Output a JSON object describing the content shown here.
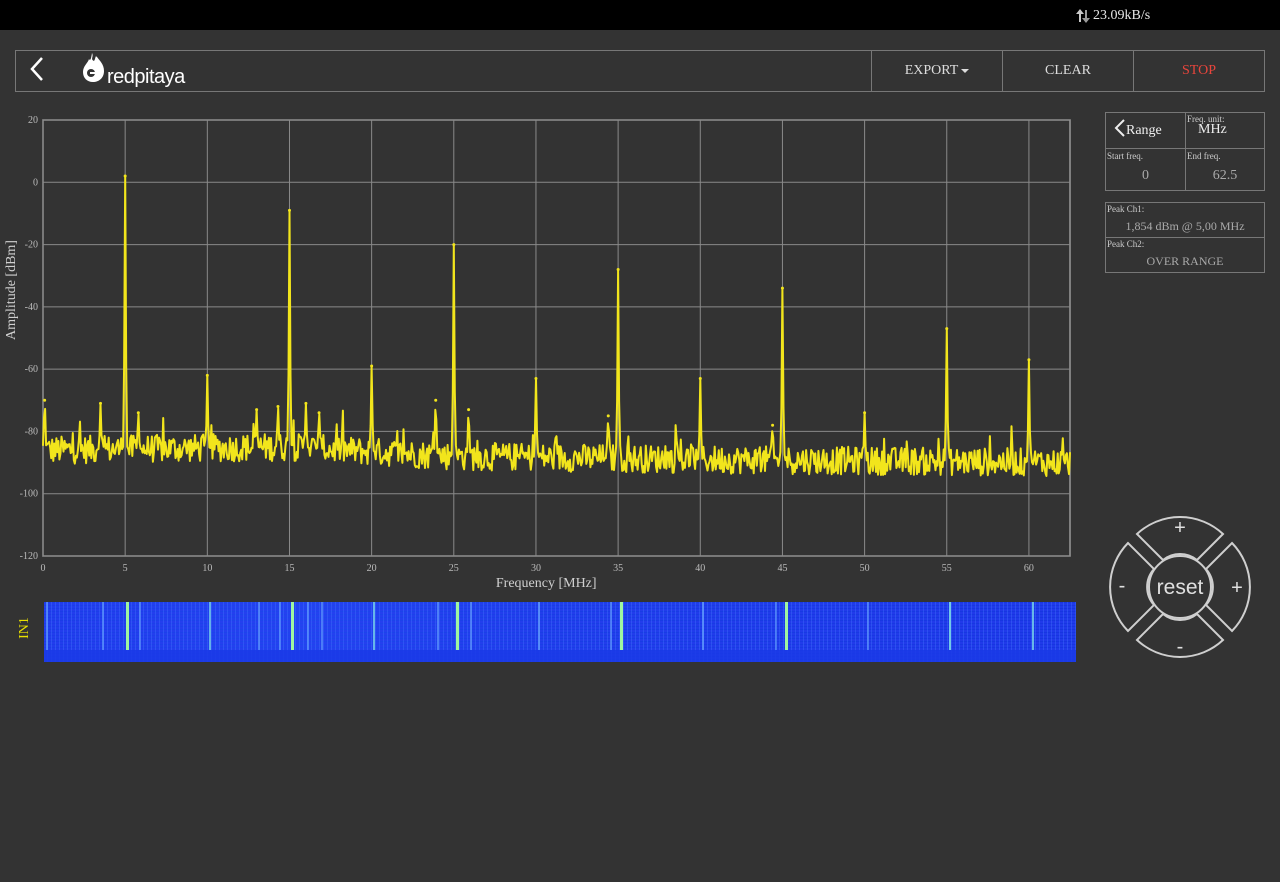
{
  "status_bar": {
    "transfer_rate": "23.09kB/s",
    "transfer_icon": "up-down-arrows-icon"
  },
  "header": {
    "back_icon": "chevron-left-icon",
    "logo_text": "redpitaya",
    "export_label": "EXPORT",
    "clear_label": "CLEAR",
    "stop_label": "STOP",
    "stop_color": "#e8453c"
  },
  "settings": {
    "range_label": "Range",
    "freq_unit_label": "Freq.  unit:",
    "freq_unit_value": "MHz",
    "start_freq_label": "Start  freq.",
    "start_freq_value": "0",
    "end_freq_label": "End  freq.",
    "end_freq_value": "62.5"
  },
  "peaks": {
    "ch1_label": "Peak  Ch1:",
    "ch1_value": "1,854  dBm  @  5,00  MHz",
    "ch2_label": "Peak  Ch2:",
    "ch2_value": "OVER RANGE"
  },
  "waterfall": {
    "channel_label": "IN1"
  },
  "dpad": {
    "center_label": "reset",
    "up": "+",
    "down": "-",
    "left": "-",
    "right": "+"
  },
  "colors": {
    "trace": "#f2e51c",
    "background": "#333333",
    "grid": "#8a8a8a",
    "waterfall": "#1a3ee8"
  },
  "chart_data": {
    "type": "line",
    "xlabel": "Frequency    [MHz]",
    "ylabel": "Amplitude  [dBm]",
    "xlim": [
      0,
      62.5
    ],
    "ylim": [
      -120,
      20
    ],
    "xticks": [
      0,
      5,
      10,
      15,
      20,
      25,
      30,
      35,
      40,
      45,
      50,
      55,
      60
    ],
    "yticks": [
      20,
      0,
      -20,
      -40,
      -60,
      -80,
      -100,
      -120
    ],
    "grid": true,
    "noise_floor": [
      [
        0,
        -86
      ],
      [
        15,
        -85
      ],
      [
        25,
        -88
      ],
      [
        40,
        -89
      ],
      [
        62.5,
        -90
      ]
    ],
    "peaks": [
      {
        "x": 0.1,
        "y": -70
      },
      {
        "x": 3.5,
        "y": -71
      },
      {
        "x": 5,
        "y": 2
      },
      {
        "x": 5.8,
        "y": -74
      },
      {
        "x": 10,
        "y": -62
      },
      {
        "x": 13,
        "y": -73
      },
      {
        "x": 14.3,
        "y": -72
      },
      {
        "x": 15,
        "y": -9
      },
      {
        "x": 16,
        "y": -71
      },
      {
        "x": 16.8,
        "y": -74
      },
      {
        "x": 20,
        "y": -59
      },
      {
        "x": 23.9,
        "y": -70
      },
      {
        "x": 25,
        "y": -20
      },
      {
        "x": 25.9,
        "y": -73
      },
      {
        "x": 30,
        "y": -63
      },
      {
        "x": 34.4,
        "y": -75
      },
      {
        "x": 35,
        "y": -28
      },
      {
        "x": 40,
        "y": -63
      },
      {
        "x": 44.4,
        "y": -78
      },
      {
        "x": 45,
        "y": -34
      },
      {
        "x": 50,
        "y": -74
      },
      {
        "x": 55,
        "y": -47
      },
      {
        "x": 60,
        "y": -57
      }
    ]
  }
}
